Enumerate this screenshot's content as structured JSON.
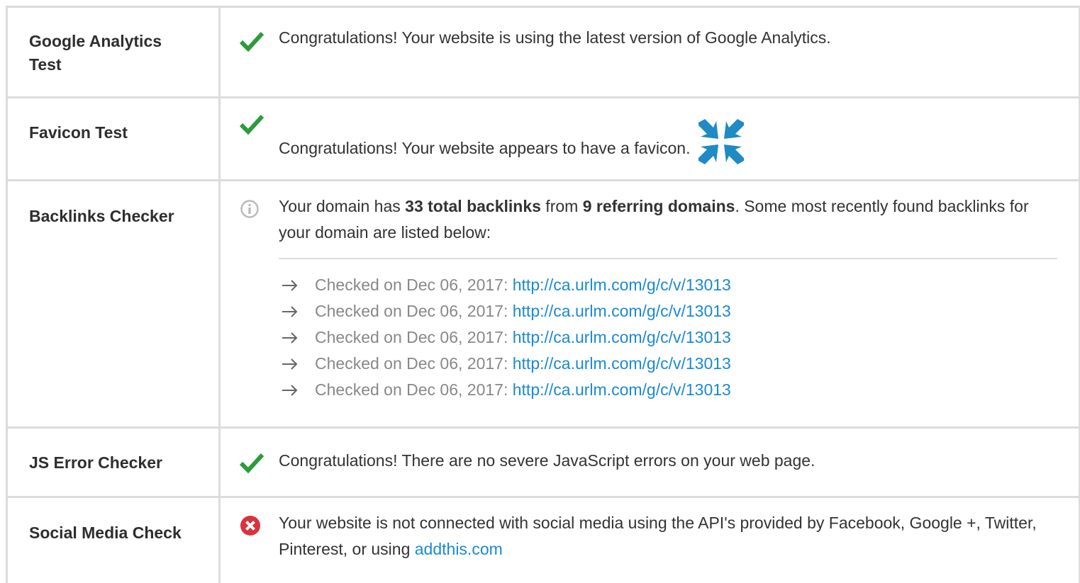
{
  "colors": {
    "border": "#dcdcdc",
    "pass": "#2c9c3a",
    "fail": "#d9333f",
    "info": "#bbbbbb",
    "link": "#1a8ad4",
    "favicon": "#1f8ac4"
  },
  "rows": [
    {
      "label": "Google Analytics Test",
      "status_icon": "check-icon",
      "message": "Congratulations! Your website is using the latest version of Google Analytics."
    },
    {
      "label": "Favicon Test",
      "status_icon": "check-icon",
      "message": "Congratulations! Your website appears to have a favicon.",
      "favicon_icon": "favicon-arrows-icon"
    },
    {
      "label": "Backlinks Checker",
      "status_icon": "info-icon",
      "message_pre": "Your domain has ",
      "backlink_count": "33 total backlinks",
      "message_mid": " from ",
      "referring_domains": "9 referring domains",
      "message_post": ". Some most recently found backlinks for your domain are listed below:",
      "backlinks": [
        {
          "checked": "Checked on Dec 06, 2017: ",
          "url": "http://ca.urlm.com/g/c/v/13013"
        },
        {
          "checked": "Checked on Dec 06, 2017: ",
          "url": "http://ca.urlm.com/g/c/v/13013"
        },
        {
          "checked": "Checked on Dec 06, 2017: ",
          "url": "http://ca.urlm.com/g/c/v/13013"
        },
        {
          "checked": "Checked on Dec 06, 2017: ",
          "url": "http://ca.urlm.com/g/c/v/13013"
        },
        {
          "checked": "Checked on Dec 06, 2017: ",
          "url": "http://ca.urlm.com/g/c/v/13013"
        }
      ]
    },
    {
      "label": "JS Error Checker",
      "status_icon": "check-icon",
      "message": "Congratulations! There are no severe JavaScript errors on your web page."
    },
    {
      "label": "Social Media Check",
      "status_icon": "error-icon",
      "message": "Your website is not connected with social media using the API's provided by Facebook, Google +, Twitter, Pinterest, or using ",
      "link_text": "addthis.com"
    }
  ]
}
